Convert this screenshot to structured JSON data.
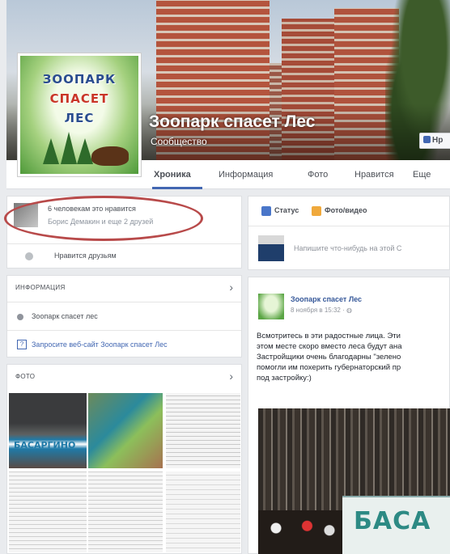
{
  "page": {
    "name": "Зоопарк спасет Лес",
    "category": "Сообщество",
    "like_button": "Нр",
    "logo_lines": [
      "ЗООПАРК",
      "СПАСЕТ",
      "ЛЕС"
    ]
  },
  "tabs": [
    {
      "label": "Хроника",
      "active": true
    },
    {
      "label": "Информация"
    },
    {
      "label": "Фото"
    },
    {
      "label": "Нравится"
    },
    {
      "label": "Еще"
    }
  ],
  "likers": {
    "count_text": "6 человекам это нравится",
    "names_text": "Борис Демакин и еще 2 друзей",
    "friends_label": "Нравится друзьям"
  },
  "info": {
    "title": "ИНФОРМАЦИЯ",
    "about": "Зоопарк спасет лес",
    "website_link": "Запросите веб-сайт Зоопарк спасет Лес"
  },
  "photos": {
    "title": "ФОТО",
    "banner_small": "БАСАРГИНО"
  },
  "composer": {
    "status_label": "Статус",
    "photo_label": "Фото/видео",
    "placeholder": "Напишите что-нибудь на этой С"
  },
  "post": {
    "author": "Зоопарк спасет Лес",
    "time": "8 ноября в 15:32 · ",
    "text_lines": [
      "Всмотритесь в эти радостные лица. Эти",
      "этом месте скоро вместо леса будут ана",
      "Застройщики очень благодарны \"зелено",
      "помогли им похерить губернаторский пр",
      "под застройку:)"
    ],
    "banner_text": "БАСА"
  },
  "colors": {
    "accent": "#4267b2",
    "link": "#365899",
    "annotation_circle": "#b84a4a",
    "background": "#e9ebee"
  }
}
